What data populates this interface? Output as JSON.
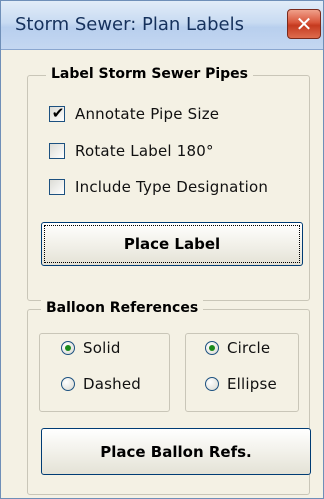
{
  "window": {
    "title": "Storm Sewer: Plan Labels",
    "close_glyph": "✕"
  },
  "label_pipes": {
    "group_label": "Label Storm Sewer Pipes",
    "options": [
      {
        "label": "Annotate Pipe Size",
        "checked": true
      },
      {
        "label": "Rotate Label 180°",
        "checked": false
      },
      {
        "label": "Include Type Designation",
        "checked": false
      }
    ],
    "place_label_button": "Place Label"
  },
  "balloon": {
    "group_label": "Balloon References",
    "fill_options": [
      {
        "label": "Solid",
        "selected": true
      },
      {
        "label": "Dashed",
        "selected": false
      }
    ],
    "shape_options": [
      {
        "label": "Circle",
        "selected": true
      },
      {
        "label": "Ellipse",
        "selected": false
      }
    ],
    "place_button": "Place Ballon Refs."
  },
  "colors": {
    "radio_dot": "#1a8a1a",
    "close_red": "#c53a1f",
    "button_border": "#003c74"
  }
}
